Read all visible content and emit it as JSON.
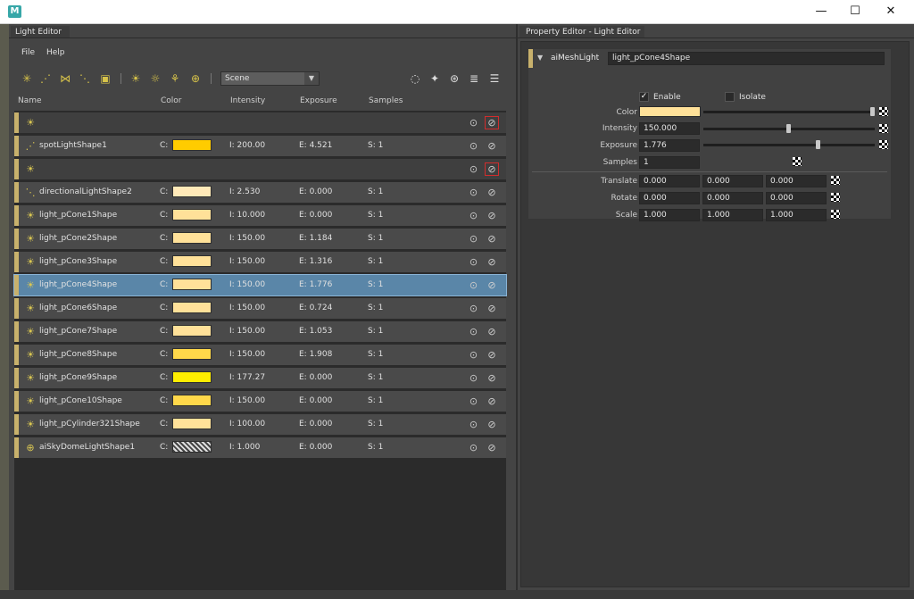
{
  "window": {
    "app_icon": "M",
    "controls": {
      "minimize": "—",
      "maximize": "☐",
      "close": "✕"
    }
  },
  "left_panel": {
    "tab": "Light Editor",
    "menu": [
      "File",
      "Help"
    ],
    "toolbar": {
      "scene_value": "Scene"
    },
    "columns": [
      "Name",
      "Color",
      "Intensity",
      "Exposure",
      "Samples"
    ],
    "rows": [
      {
        "name": "",
        "group": true
      },
      {
        "name": "spotLightShape1",
        "c": "C:",
        "color": "#ffcc00",
        "i": "I: 200.00",
        "e": "E: 4.521",
        "s": "S: 1"
      },
      {
        "name": "",
        "group": true
      },
      {
        "name": "directionalLightShape2",
        "c": "C:",
        "color": "#ffe9b8",
        "i": "I: 2.530",
        "e": "E: 0.000",
        "s": "S: 1"
      },
      {
        "name": "light_pCone1Shape",
        "c": "C:",
        "color": "#ffe199",
        "i": "I: 10.000",
        "e": "E: 0.000",
        "s": "S: 1"
      },
      {
        "name": "light_pCone2Shape",
        "c": "C:",
        "color": "#ffe199",
        "i": "I: 150.00",
        "e": "E: 1.184",
        "s": "S: 1"
      },
      {
        "name": "light_pCone3Shape",
        "c": "C:",
        "color": "#ffe199",
        "i": "I: 150.00",
        "e": "E: 1.316",
        "s": "S: 1"
      },
      {
        "name": "light_pCone4Shape",
        "c": "C:",
        "color": "#ffe199",
        "i": "I: 150.00",
        "e": "E: 1.776",
        "s": "S: 1",
        "selected": true
      },
      {
        "name": "light_pCone6Shape",
        "c": "C:",
        "color": "#ffe199",
        "i": "I: 150.00",
        "e": "E: 0.724",
        "s": "S: 1"
      },
      {
        "name": "light_pCone7Shape",
        "c": "C:",
        "color": "#ffe199",
        "i": "I: 150.00",
        "e": "E: 1.053",
        "s": "S: 1"
      },
      {
        "name": "light_pCone8Shape",
        "c": "C:",
        "color": "#ffd84a",
        "i": "I: 150.00",
        "e": "E: 1.908",
        "s": "S: 1"
      },
      {
        "name": "light_pCone9Shape",
        "c": "C:",
        "color": "#ffee00",
        "i": "I: 177.27",
        "e": "E: 0.000",
        "s": "S: 1"
      },
      {
        "name": "light_pCone10Shape",
        "c": "C:",
        "color": "#ffd84a",
        "i": "I: 150.00",
        "e": "E: 0.000",
        "s": "S: 1"
      },
      {
        "name": "light_pCylinder321Shape",
        "c": "C:",
        "color": "#ffe199",
        "i": "I: 100.00",
        "e": "E: 0.000",
        "s": "S: 1"
      },
      {
        "name": "aiSkyDomeLightShape1",
        "c": "C:",
        "color": "checker",
        "i": "I: 1.000",
        "e": "E: 0.000",
        "s": "S: 1"
      }
    ]
  },
  "right_panel": {
    "tab": "Property Editor - Light Editor",
    "node_type": "aiMeshLight",
    "node_name": "light_pCone4Shape",
    "enable_label": "Enable",
    "enable_checked": true,
    "isolate_label": "Isolate",
    "isolate_checked": false,
    "color_label": "Color",
    "color_value": "#ffe199",
    "intensity_label": "Intensity",
    "intensity_value": "150.000",
    "exposure_label": "Exposure",
    "exposure_value": "1.776",
    "samples_label": "Samples",
    "samples_value": "1",
    "translate_label": "Translate",
    "translate": [
      "0.000",
      "0.000",
      "0.000"
    ],
    "rotate_label": "Rotate",
    "rotate": [
      "0.000",
      "0.000",
      "0.000"
    ],
    "scale_label": "Scale",
    "scale": [
      "1.000",
      "1.000",
      "1.000"
    ]
  }
}
